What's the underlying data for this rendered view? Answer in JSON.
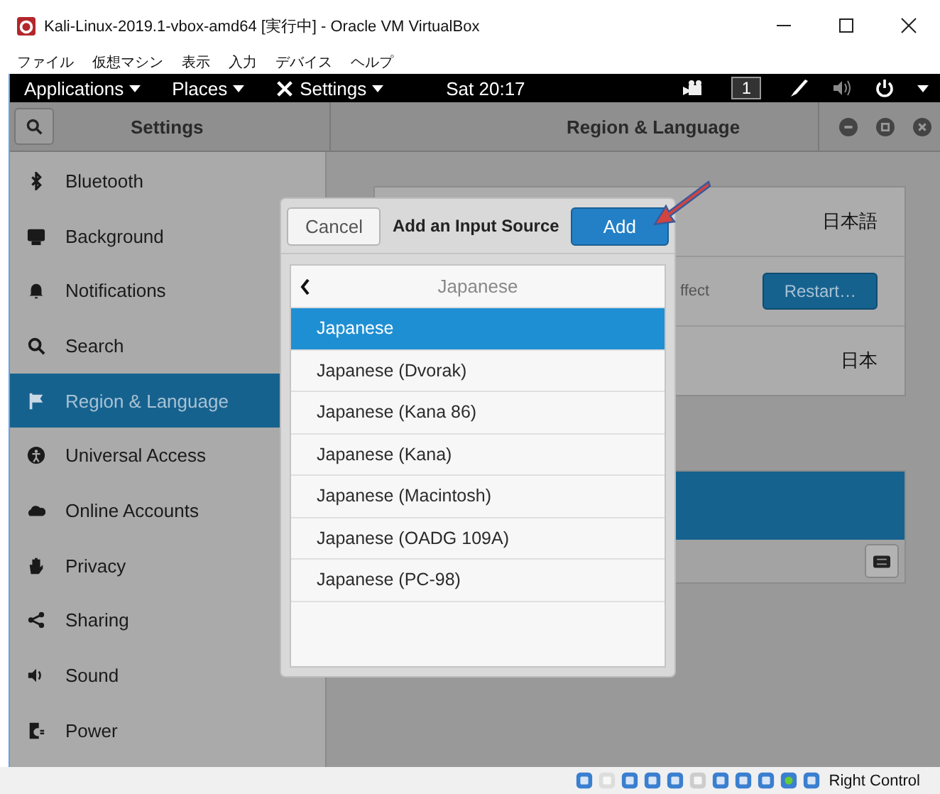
{
  "window": {
    "title": "Kali-Linux-2019.1-vbox-amd64 [実行中] - Oracle VM VirtualBox"
  },
  "menu_bar": [
    "ファイル",
    "仮想マシン",
    "表示",
    "入力",
    "デバイス",
    "ヘルプ"
  ],
  "top_bar": {
    "menus": [
      "Applications",
      "Places",
      "Settings"
    ],
    "clock": "Sat 20:17",
    "workspace": "1"
  },
  "settings": {
    "title": "Settings",
    "panel_title": "Region & Language",
    "sidebar": [
      {
        "label": "Bluetooth",
        "selected": false
      },
      {
        "label": "Background",
        "selected": false
      },
      {
        "label": "Notifications",
        "selected": false
      },
      {
        "label": "Search",
        "selected": false
      },
      {
        "label": "Region & Language",
        "selected": true
      },
      {
        "label": "Universal Access",
        "selected": false
      },
      {
        "label": "Online Accounts",
        "selected": false
      },
      {
        "label": "Privacy",
        "selected": false
      },
      {
        "label": "Sharing",
        "selected": false
      },
      {
        "label": "Sound",
        "selected": false
      },
      {
        "label": "Power",
        "selected": false
      }
    ]
  },
  "content": {
    "language_value": "日本語",
    "restart_note": "ffect",
    "restart_button": "Restart…",
    "formats_value": "日本"
  },
  "dialog": {
    "cancel": "Cancel",
    "title": "Add an Input Source",
    "add": "Add",
    "header": "Japanese",
    "items": [
      {
        "label": "Japanese",
        "selected": true
      },
      {
        "label": "Japanese (Dvorak)",
        "selected": false
      },
      {
        "label": "Japanese (Kana 86)",
        "selected": false
      },
      {
        "label": "Japanese (Kana)",
        "selected": false
      },
      {
        "label": "Japanese (Macintosh)",
        "selected": false
      },
      {
        "label": "Japanese (OADG 109A)",
        "selected": false
      },
      {
        "label": "Japanese (PC-98)",
        "selected": false
      }
    ]
  },
  "status_bar": {
    "host_key": "Right Control"
  }
}
